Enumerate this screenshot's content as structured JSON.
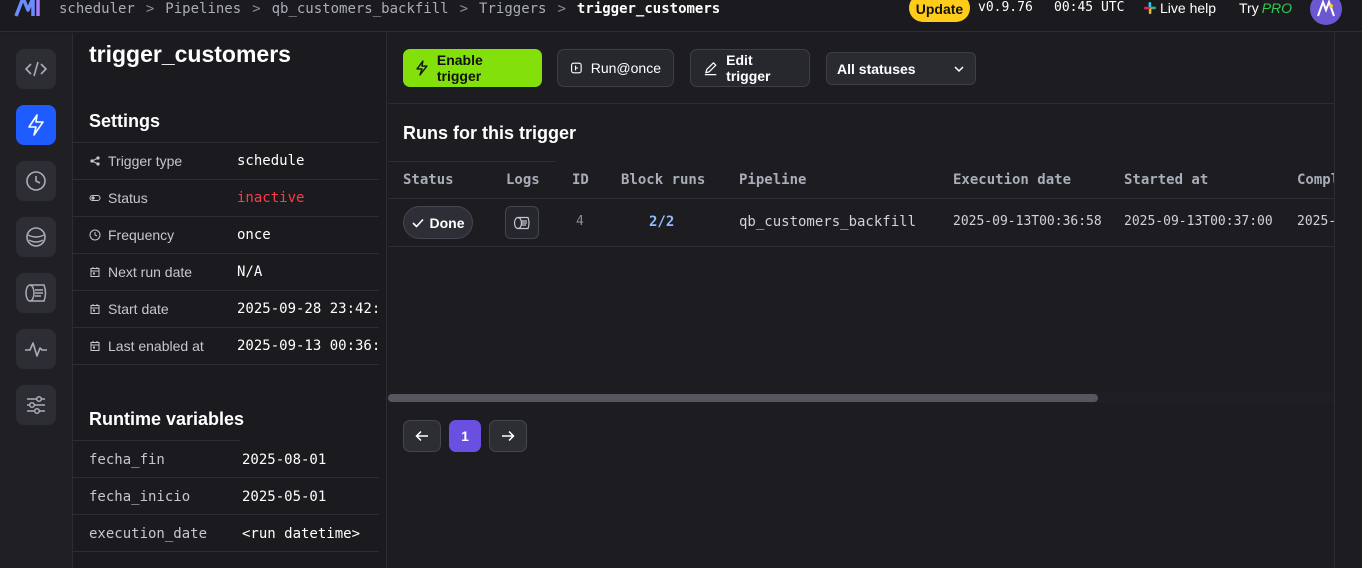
{
  "topbar": {
    "breadcrumbs": [
      "scheduler",
      "Pipelines",
      "qb_customers_backfill",
      "Triggers",
      "trigger_customers"
    ],
    "separator": ">",
    "update_label": "Update",
    "version": "v0.9.76",
    "time": "00:45 UTC",
    "live_help_label": "Live help",
    "try_label": "Try",
    "pro_label": "PRO"
  },
  "rail": {
    "icons": [
      "code-icon",
      "lightning-icon",
      "clock-icon",
      "planet-icon",
      "terminal-icon",
      "pulse-icon",
      "sliders-icon"
    ],
    "active": "lightning-icon"
  },
  "settings": {
    "title": "trigger_customers",
    "heading": "Settings",
    "rows": [
      {
        "label": "Trigger type",
        "value": "schedule",
        "icon": "share-icon"
      },
      {
        "label": "Status",
        "value": "inactive",
        "icon": "toggle-icon"
      },
      {
        "label": "Frequency",
        "value": "once",
        "icon": "clock-icon"
      },
      {
        "label": "Next run date",
        "value": "N/A",
        "icon": "calendar-icon"
      },
      {
        "label": "Start date",
        "value": "2025-09-28 23:42:",
        "icon": "calendar-icon"
      },
      {
        "label": "Last enabled at",
        "value": "2025-09-13 00:36:",
        "icon": "calendar-icon"
      }
    ],
    "runtime_heading": "Runtime variables",
    "variables": [
      {
        "key": "fecha_fin",
        "value": "2025-08-01"
      },
      {
        "key": "fecha_inicio",
        "value": "2025-05-01"
      },
      {
        "key": "execution_date",
        "value": "<run datetime>"
      }
    ]
  },
  "toolbar": {
    "enable_label": "Enable trigger",
    "run_once_label": "Run@once",
    "edit_label": "Edit trigger",
    "status_filter": "All statuses"
  },
  "runs": {
    "title": "Runs for this trigger",
    "columns": [
      "Status",
      "Logs",
      "ID",
      "Block runs",
      "Pipeline",
      "Execution date",
      "Started at",
      "Compl"
    ],
    "rows": [
      {
        "status": "Done",
        "id": "4",
        "block_runs": "2/2",
        "pipeline": "qb_customers_backfill",
        "execution_date": "2025-09-13T00:36:58",
        "started_at": "2025-09-13T00:37:00",
        "completed_at": "2025-"
      }
    ],
    "scroll_fraction": 0.75
  },
  "pagination": {
    "current_page": "1",
    "prev_icon": "arrow-left-icon",
    "next_icon": "arrow-right-icon"
  },
  "colors": {
    "accent_green": "#84e00a",
    "active_blue": "#1f5cff",
    "inactive_red": "#ff3b48",
    "page_purple": "#6b4fe0",
    "update_yellow": "#ffcc19"
  }
}
